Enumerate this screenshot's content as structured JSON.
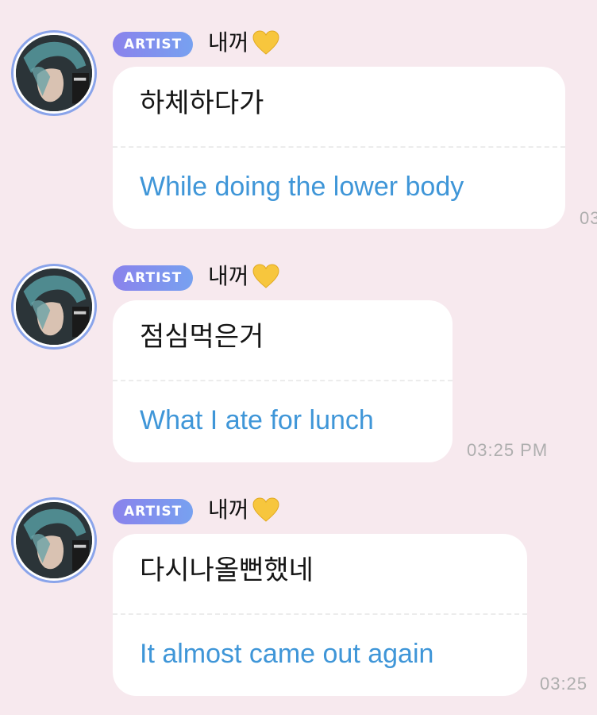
{
  "messages": [
    {
      "badge": "ARTIST",
      "sender": "내꺼",
      "heart": "yellow-heart-emoji",
      "korean": "하체하다가",
      "english": "While doing the lower body",
      "time": "03"
    },
    {
      "badge": "ARTIST",
      "sender": "내꺼",
      "heart": "yellow-heart-emoji",
      "korean": "점심먹은거",
      "english": "What I ate for lunch",
      "time": "03:25 PM"
    },
    {
      "badge": "ARTIST",
      "sender": "내꺼",
      "heart": "yellow-heart-emoji",
      "korean": "다시나올뻔했네",
      "english": "It almost came out again",
      "time": "03:25"
    }
  ],
  "colors": {
    "background": "#f7e9ee",
    "badge_start": "#8a82ec",
    "badge_end": "#77a1f0",
    "translation_text": "#3f96d8",
    "timestamp": "#aeaeae",
    "heart": "#f7c63d"
  }
}
